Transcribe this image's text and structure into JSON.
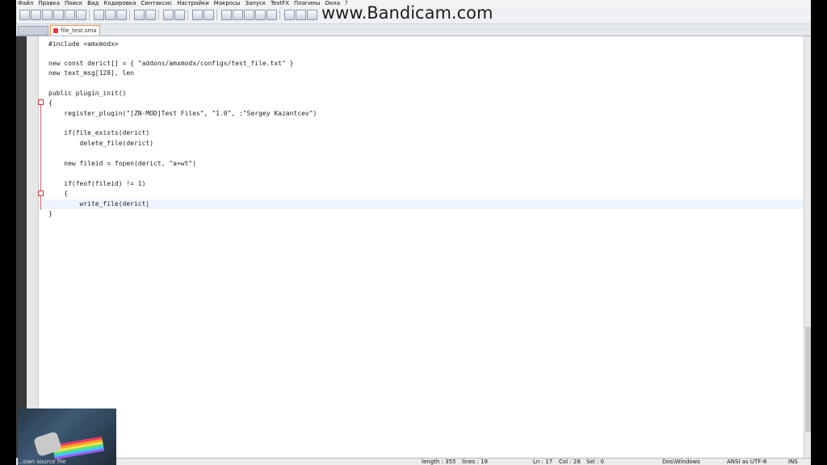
{
  "menu": [
    "Файл",
    "Правка",
    "Поиск",
    "Вид",
    "Кодировка",
    "Синтаксис",
    "Настройки",
    "Макросы",
    "Запуск",
    "TextFX",
    "Плагины",
    "Окна",
    "?"
  ],
  "watermark": "www.Bandicam.com",
  "tab": {
    "filename": "file_test.sma"
  },
  "code": [
    {
      "text": "#include <amxmodx>",
      "line_index": 0
    },
    {
      "text": "new const derict[] = { \"addons/amxmodx/configs/test_file.txt\" }",
      "line_index": 2
    },
    {
      "text": "new text_msg[128], len",
      "line_index": 3
    },
    {
      "text": "public plugin_init()",
      "line_index": 5
    },
    {
      "text": "{",
      "line_index": 6
    },
    {
      "text": "    register_plugin(\"[ZN-MOD]Test Files\", \"1.0\", :\"Sergey Kazantcev\")",
      "line_index": 7
    },
    {
      "text": "    if(file_exists(derict)",
      "line_index": 9
    },
    {
      "text": "        delete_file(derict)",
      "line_index": 10
    },
    {
      "text": "    new fileid = fopen(derict, \"a+wt\")",
      "line_index": 12
    },
    {
      "text": "    if(feof(fileid) != 1)",
      "line_index": 14
    },
    {
      "text": "    {",
      "line_index": 15
    },
    {
      "text": "        write_file(derict|",
      "line_index": 16
    },
    {
      "text": "}",
      "line_index": 17
    }
  ],
  "status": {
    "length": "length : 355",
    "lines": "lines : 19",
    "ln": "Ln : 17",
    "col": "Col : 28",
    "sel": "Sel : 0",
    "eol": "Dos\\Windows",
    "encoding": "ANSI as UTF-8",
    "mode": "INS"
  },
  "overlay_caption": "...own source file"
}
